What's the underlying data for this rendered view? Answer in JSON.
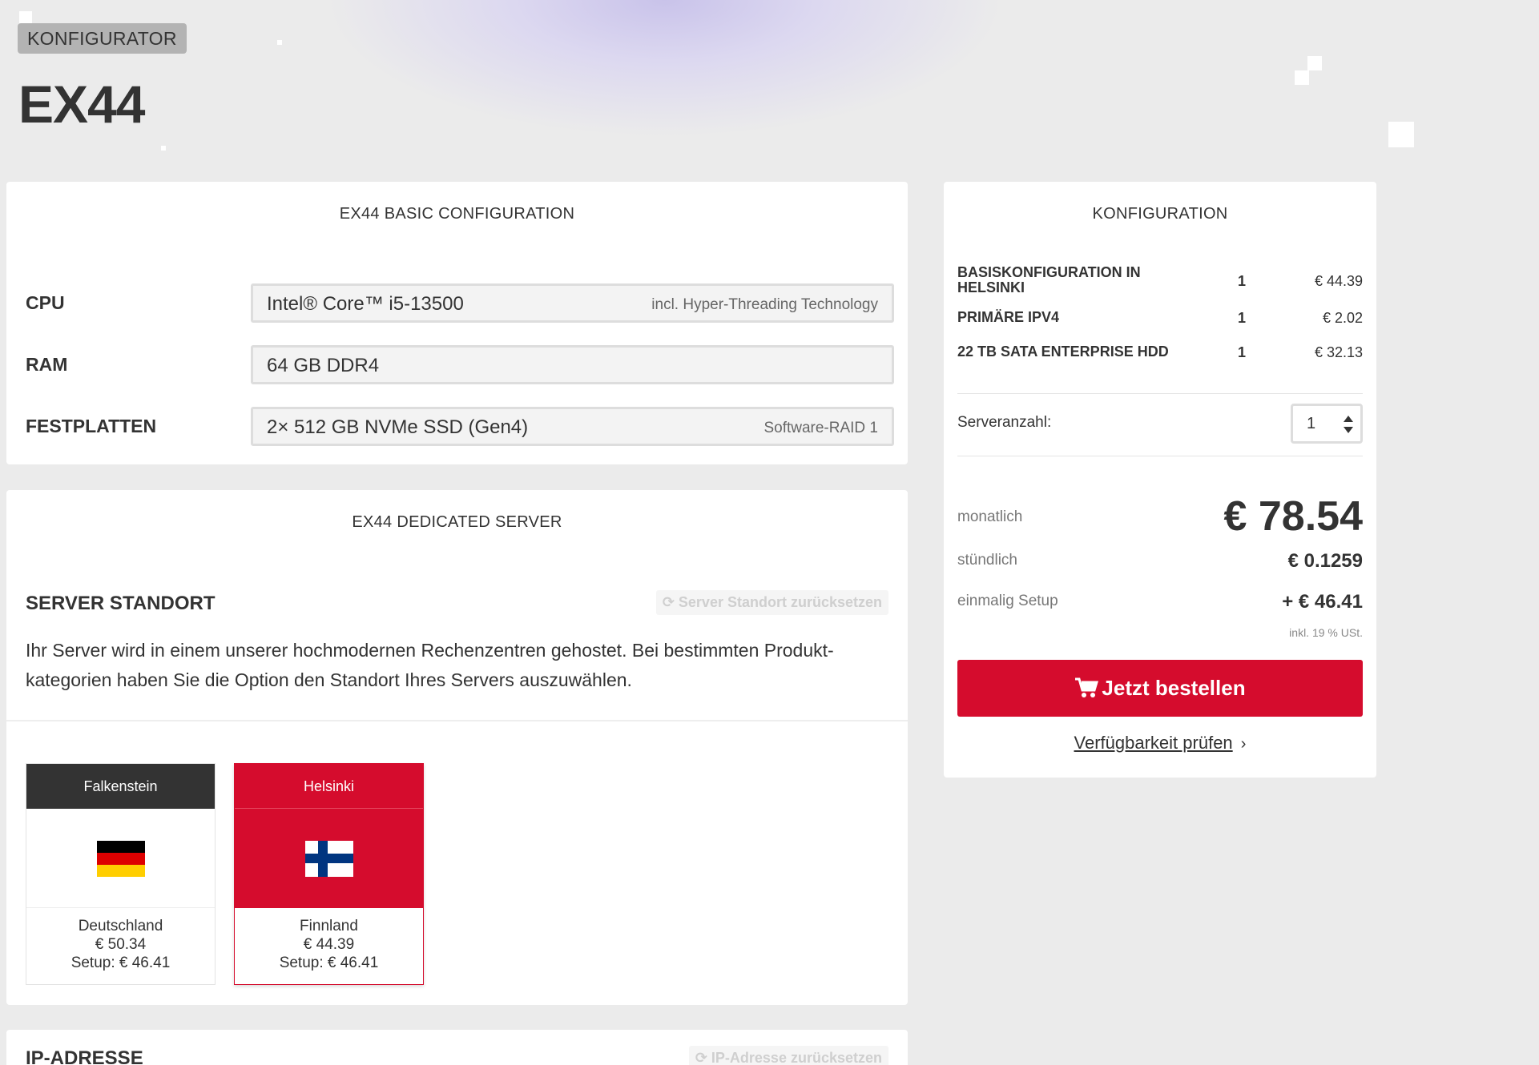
{
  "header": {
    "badge": "KONFIGURATOR",
    "title": "EX44"
  },
  "basic_config": {
    "title": "EX44 BASIC CONFIGURATION",
    "rows": [
      {
        "label": "CPU",
        "value": "Intel® Core™ i5-13500",
        "note": "incl. Hyper-Threading Technology"
      },
      {
        "label": "RAM",
        "value": "64 GB DDR4",
        "note": ""
      },
      {
        "label": "FESTPLATTEN",
        "value": "2× 512 GB NVMe SSD (Gen4)",
        "note": "Software-RAID 1"
      }
    ]
  },
  "dedicated": {
    "title": "EX44 DEDICATED SERVER",
    "section_title": "SERVER STANDORT",
    "reset_label": "Server Standort zurücksetzen",
    "description": "Ihr Server wird in einem unserer hochmodernen Rechenzentren gehostet. Bei bestimmten Produkt­kategorien haben Sie die Option den Standort Ihres Servers auszuwählen.",
    "locations": [
      {
        "name": "Falkenstein",
        "country": "Deutschland",
        "price": "€ 50.34",
        "setup": "Setup: € 46.41",
        "flag": "de-flag-icon",
        "selected": false
      },
      {
        "name": "Helsinki",
        "country": "Finnland",
        "price": "€ 44.39",
        "setup": "Setup: € 46.41",
        "flag": "fi-flag-icon",
        "selected": true
      }
    ]
  },
  "ip": {
    "title": "IP-ADRESSE",
    "reset_label": "IP-Adresse zurücksetzen"
  },
  "summary": {
    "title": "KONFIGURATION",
    "items": [
      {
        "label": "BASISKONFIGURATION IN HELSINKI",
        "qty": "1",
        "price": "€ 44.39"
      },
      {
        "label": "PRIMÄRE IPV4",
        "qty": "1",
        "price": "€ 2.02"
      },
      {
        "label": "22 TB SATA ENTERPRISE HDD",
        "qty": "1",
        "price": "€ 32.13"
      }
    ],
    "server_count_label": "Serveranzahl:",
    "server_count": "1",
    "monthly_label": "monatlich",
    "monthly": "€ 78.54",
    "hourly_label": "stündlich",
    "hourly": "€ 0.1259",
    "setup_label": "einmalig Setup",
    "setup": "+ € 46.41",
    "vat_note": "inkl. 19 % USt.",
    "order_label": "Jetzt bestellen",
    "availability_label": "Verfügbarkeit prüfen"
  },
  "colors": {
    "accent": "#d50c2d",
    "dark": "#333333",
    "background": "#ebebeb"
  }
}
